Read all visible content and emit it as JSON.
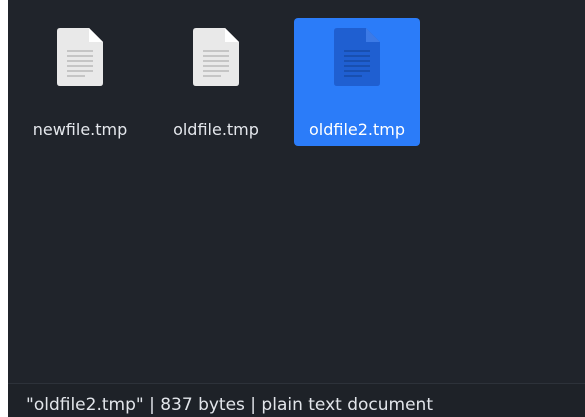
{
  "files": [
    {
      "name": "newfile.tmp",
      "icon": "text-document-icon",
      "selected": false
    },
    {
      "name": "oldfile.tmp",
      "icon": "text-document-icon",
      "selected": false
    },
    {
      "name": "oldfile2.tmp",
      "icon": "text-document-icon",
      "selected": true
    }
  ],
  "status_bar": {
    "text": "\"oldfile2.tmp\" | 837 bytes | plain text document"
  },
  "colors": {
    "background": "#20242b",
    "selection": "#2b7cf9",
    "icon_page": "#e8e8e8",
    "icon_page_selected": "#1f5fd1"
  }
}
